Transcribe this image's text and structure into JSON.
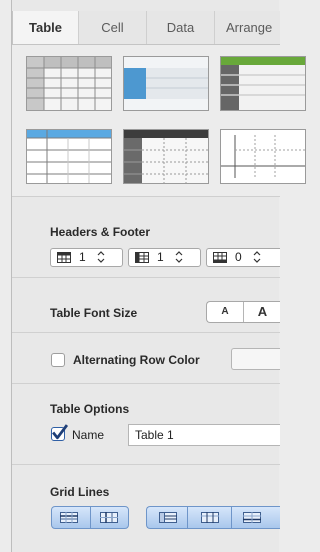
{
  "tabs": [
    {
      "label": "Table"
    },
    {
      "label": "Cell"
    },
    {
      "label": "Data"
    },
    {
      "label": "Arrange"
    }
  ],
  "sections": {
    "headers_footer": {
      "title": "Headers & Footer",
      "header_rows": "1",
      "header_columns": "1",
      "footer_rows": "0"
    },
    "font_size": {
      "title": "Table Font Size",
      "smaller_label": "A",
      "larger_label": "A"
    },
    "alternating": {
      "title": "Alternating Row Color",
      "checked": false
    },
    "options": {
      "title": "Table Options",
      "name_checkbox_label": "Name",
      "name_checked": true,
      "name_value": "Table 1"
    },
    "grid_lines": {
      "title": "Grid Lines"
    }
  },
  "colors": {
    "accent_blue": "#3b7fd4",
    "style_blue": "#4d98d0",
    "style_green": "#68a83a",
    "style_dark": "#555555"
  },
  "icons": [
    "header-rows-icon",
    "header-columns-icon",
    "footer-rows-icon",
    "stepper-arrows-icon",
    "checkmark-icon",
    "grid-lines-icon"
  ]
}
